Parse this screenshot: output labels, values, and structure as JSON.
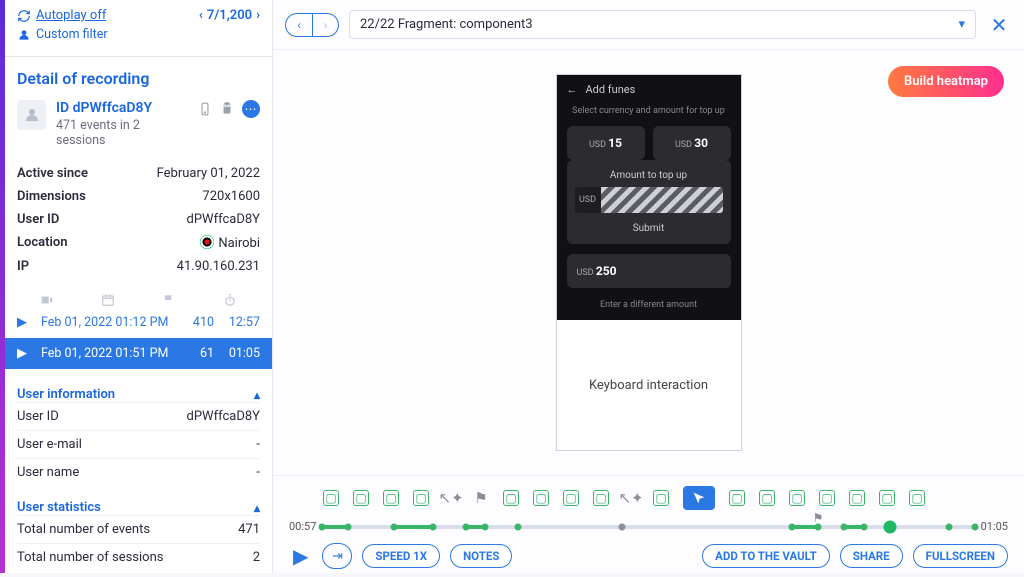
{
  "toplinks": {
    "autoplay": "Autoplay off",
    "filter": "Custom filter",
    "pager": "7/1,200"
  },
  "detail_title": "Detail of recording",
  "identity": {
    "id_label": "ID dPWffcaD8Y",
    "subtitle": "471 events in 2 sessions"
  },
  "meta": [
    {
      "k": "Active since",
      "v": "February 01, 2022"
    },
    {
      "k": "Dimensions",
      "v": "720x1600"
    },
    {
      "k": "User ID",
      "v": "dPWffcaD8Y"
    },
    {
      "k": "Location",
      "v": "Nairobi",
      "flag": true
    },
    {
      "k": "IP",
      "v": "41.90.160.231"
    }
  ],
  "sessions": [
    {
      "time": "Feb 01, 2022  01:12 PM",
      "events": "410",
      "dur": "12:57",
      "active": false
    },
    {
      "time": "Feb 01, 2022  01:51 PM",
      "events": "61",
      "dur": "01:05",
      "active": true
    }
  ],
  "user_info": {
    "title": "User information",
    "rows": [
      {
        "k": "User ID",
        "v": "dPWffcaD8Y"
      },
      {
        "k": "User e-mail",
        "v": "-"
      },
      {
        "k": "User name",
        "v": "-"
      }
    ]
  },
  "user_stats": {
    "title": "User statistics",
    "rows": [
      {
        "k": "Total number of events",
        "v": "471"
      },
      {
        "k": "Total number of sessions",
        "v": "2"
      }
    ]
  },
  "fragment_label": "22/22 Fragment: component3",
  "heatmap_label": "Build heatmap",
  "device": {
    "title": "Add funes",
    "subtitle": "Select currency and amount for top up",
    "chip1_pre": "USD",
    "chip1_val": "15",
    "chip2_pre": "USD",
    "chip2_val": "30",
    "modal_title": "Amount to top up",
    "currency": "USD",
    "submit": "Submit",
    "chip3_pre": "USD",
    "chip3_val": "250",
    "diff_link": "Enter a different amount",
    "keyboard": "Keyboard interaction"
  },
  "timeline": {
    "start": "00:57",
    "end": "01:05"
  },
  "controls": {
    "speed": "SPEED 1X",
    "notes": "NOTES",
    "vault": "ADD TO THE VAULT",
    "share": "SHARE",
    "fullscreen": "FULLSCREEN"
  }
}
